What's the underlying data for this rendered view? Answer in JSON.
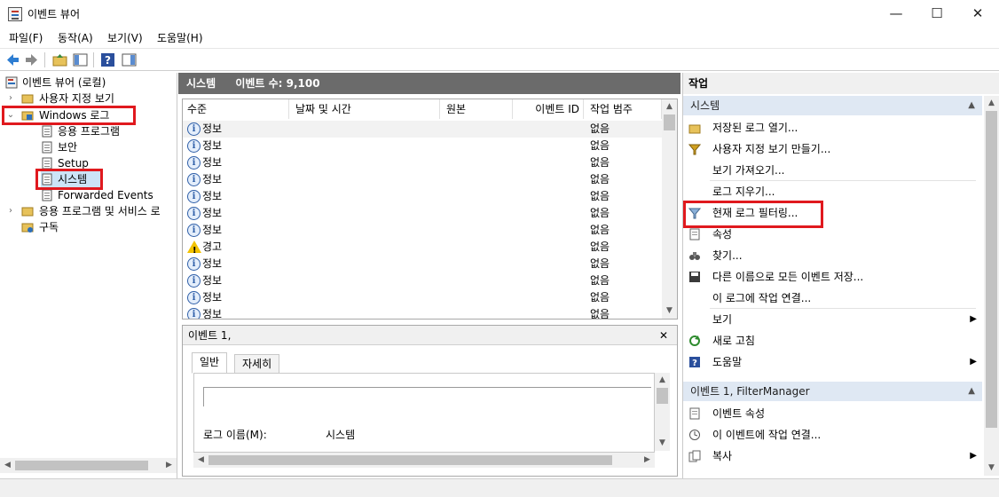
{
  "window": {
    "title": "이벤트 뷰어",
    "minimize": "—",
    "maximize": "☐",
    "close": "✕"
  },
  "menu": [
    "파일(F)",
    "동작(A)",
    "보기(V)",
    "도움말(H)"
  ],
  "tree": {
    "root": "이벤트 뷰어 (로컬)",
    "custom_views": "사용자 지정 보기",
    "windows_logs": "Windows 로그",
    "app_log": "응용 프로그램",
    "security": "보안",
    "setup": "Setup",
    "system": "시스템",
    "forwarded": "Forwarded Events",
    "apps_services": "응용 프로그램 및 서비스 로",
    "subscriptions": "구독"
  },
  "center": {
    "log_name": "시스템",
    "event_count": "이벤트 수: 9,100",
    "columns": [
      "수준",
      "날짜 및 시간",
      "원본",
      "이벤트 ID",
      "작업 범주"
    ],
    "rows": [
      {
        "level": "정보",
        "icon": "info-icon",
        "category": "없음"
      },
      {
        "level": "정보",
        "icon": "info-icon",
        "category": "없음"
      },
      {
        "level": "정보",
        "icon": "info-icon",
        "category": "없음"
      },
      {
        "level": "정보",
        "icon": "info-icon",
        "category": "없음"
      },
      {
        "level": "정보",
        "icon": "info-icon",
        "category": "없음"
      },
      {
        "level": "정보",
        "icon": "info-icon",
        "category": "없음"
      },
      {
        "level": "정보",
        "icon": "info-icon",
        "category": "없음"
      },
      {
        "level": "경고",
        "icon": "warning-icon",
        "category": "없음"
      },
      {
        "level": "정보",
        "icon": "info-icon",
        "category": "없음"
      },
      {
        "level": "정보",
        "icon": "info-icon",
        "category": "없음"
      },
      {
        "level": "정보",
        "icon": "info-icon",
        "category": "없음"
      },
      {
        "level": "정보",
        "icon": "info-icon",
        "category": "없음"
      }
    ]
  },
  "detail": {
    "title": "이벤트 1,",
    "tab_general": "일반",
    "tab_details": "자세히",
    "log_name_label": "로그 이름(M):",
    "log_name_value": "시스템"
  },
  "right": {
    "title": "작업",
    "section1": "시스템",
    "actions1": [
      {
        "label": "저장된 로그 열기...",
        "icon": "folder-open-icon"
      },
      {
        "label": "사용자 지정 보기 만들기...",
        "icon": "filter-create-icon"
      },
      {
        "label": "보기 가져오기...",
        "icon": ""
      },
      {
        "label": "로그 지우기...",
        "icon": ""
      },
      {
        "label": "현재 로그 필터링...",
        "icon": "filter-icon"
      },
      {
        "label": "속성",
        "icon": "properties-icon"
      },
      {
        "label": "찾기...",
        "icon": "binoculars-icon"
      },
      {
        "label": "다른 이름으로 모든 이벤트 저장...",
        "icon": "save-icon"
      },
      {
        "label": "이 로그에 작업 연결...",
        "icon": ""
      },
      {
        "label": "보기",
        "icon": "",
        "submenu": "▶"
      },
      {
        "label": "새로 고침",
        "icon": "refresh-icon"
      },
      {
        "label": "도움말",
        "icon": "help-icon",
        "submenu": "▶"
      }
    ],
    "section2": "이벤트 1, FilterManager",
    "actions2": [
      {
        "label": "이벤트 속성",
        "icon": "event-properties-icon"
      },
      {
        "label": "이 이벤트에 작업 연결...",
        "icon": "task-icon"
      },
      {
        "label": "복사",
        "icon": "copy-icon",
        "submenu": "▶"
      }
    ]
  },
  "colors": {
    "header_gray": "#6b6b6b",
    "section_blue": "#dfe8f3",
    "highlight_red": "#e0191e"
  }
}
